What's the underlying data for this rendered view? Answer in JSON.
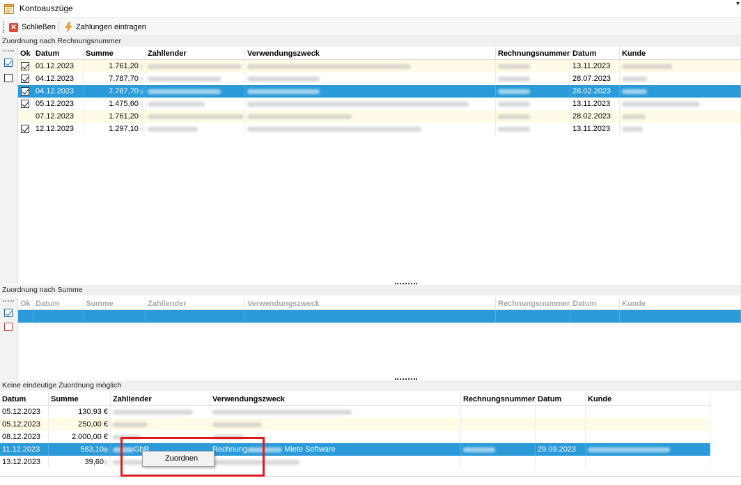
{
  "window": {
    "title": "Kontoauszüge"
  },
  "toolbar": {
    "close_label": "Schließen",
    "payments_label": "Zahlungen eintragen"
  },
  "section1": {
    "title": "Zuordnung nach Rechnungsnummer",
    "headers": {
      "ok": "Ok",
      "datum": "Datum",
      "summe": "Summe",
      "zahllender": "Zahllender",
      "verwendungszweck": "Verwendungszweck",
      "rechnungsnummer": "Rechnungsnummer",
      "datum2": "Datum",
      "kunde": "Kunde"
    },
    "rows": [
      {
        "ok": true,
        "datum": "01.12.2023",
        "summe": "1.761,20",
        "datum2": "13.11.2023",
        "style": "yellow"
      },
      {
        "ok": true,
        "datum": "04.12.2023",
        "summe": "7.787,70",
        "datum2": "28.07.2023",
        "style": "white"
      },
      {
        "ok": true,
        "datum": "04.12.2023",
        "summe": "7.787,70",
        "datum2": "28.02.2023",
        "style": "selected"
      },
      {
        "ok": true,
        "datum": "05.12.2023",
        "summe": "1.475,60",
        "datum2": "13.11.2023",
        "style": "white"
      },
      {
        "ok": false,
        "datum": "07.12.2023",
        "summe": "1.761,20",
        "datum2": "28.02.2023",
        "style": "yellow"
      },
      {
        "ok": true,
        "datum": "12.12.2023",
        "summe": "1.297,10",
        "datum2": "13.11.2023",
        "style": "white"
      }
    ]
  },
  "section2": {
    "title": "Zuordnung nach Summe",
    "headers": {
      "ok": "Ok",
      "datum": "Datum",
      "summe": "Summe",
      "zahllender": "Zahllender",
      "verwendungszweck": "Verwendungszweck",
      "rechnungsnummer": "Rechnungsnummer",
      "datum2": "Datum",
      "kunde": "Kunde"
    }
  },
  "section3": {
    "title": "Keine eindeutige Zuordnung möglich",
    "headers": {
      "datum": "Datum",
      "summe": "Summe",
      "zahllender": "Zahllender",
      "verwendungszweck": "Verwendungszweck",
      "rechnungsnummer": "Rechnungsnummer",
      "datum2": "Datum",
      "kunde": "Kunde"
    },
    "rows": [
      {
        "datum": "05.12.2023",
        "summe": "130,93 €",
        "style": "white"
      },
      {
        "datum": "05.12.2023",
        "summe": "250,00 €",
        "style": "yellow"
      },
      {
        "datum": "08.12.2023",
        "summe": "2.000,00 €",
        "style": "white"
      },
      {
        "datum": "11.12.2023",
        "summe": "583,10",
        "zahllender_tail": "GbR",
        "verwendungszweck_start": "Rechnung",
        "verwendungszweck_end": "Miete Software",
        "datum2": "29.09.2023",
        "style": "selected"
      },
      {
        "datum": "13.12.2023",
        "summe": "39,60",
        "style": "white"
      }
    ]
  },
  "context_menu": {
    "items": [
      "Zuordnen"
    ]
  },
  "colors": {
    "selection": "#2b9ad9",
    "highlight_row": "#fffbe6",
    "annotation_box": "#e0191b"
  }
}
